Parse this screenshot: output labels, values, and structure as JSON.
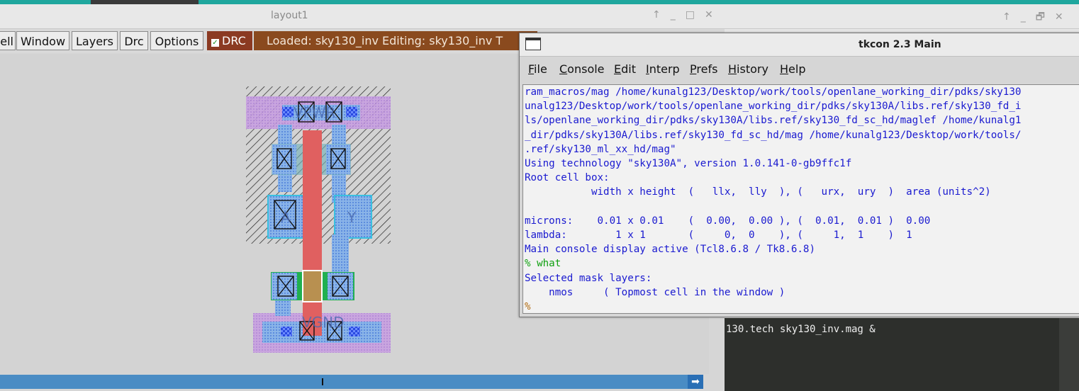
{
  "magic": {
    "title": "layout1",
    "menu": [
      "ell",
      "Window",
      "Layers",
      "Drc",
      "Options"
    ],
    "drc_label": "DRC",
    "status": "Loaded: sky130_inv Editing: sky130_inv T",
    "labels": {
      "vpwr": "VPWR",
      "vgnd": "VGND",
      "a": "A",
      "y": "Y"
    }
  },
  "tkcon": {
    "title": "tkcon 2.3 Main",
    "menu": [
      "File",
      "Console",
      "Edit",
      "Interp",
      "Prefs",
      "History",
      "Help"
    ],
    "lines": [
      {
        "text": "ram_macros/mag /home/kunalg123/Desktop/work/tools/openlane_working_dir/pdks/sky130",
        "color": "blue"
      },
      {
        "text": "unalg123/Desktop/work/tools/openlane_working_dir/pdks/sky130A/libs.ref/sky130_fd_i",
        "color": "blue"
      },
      {
        "text": "ls/openlane_working_dir/pdks/sky130A/libs.ref/sky130_fd_sc_hd/maglef /home/kunalg1",
        "color": "blue"
      },
      {
        "text": "_dir/pdks/sky130A/libs.ref/sky130_fd_sc_hd/mag /home/kunalg123/Desktop/work/tools/",
        "color": "blue"
      },
      {
        "text": ".ref/sky130_ml_xx_hd/mag\"",
        "color": "blue"
      },
      {
        "text": "Using technology \"sky130A\", version 1.0.141-0-gb9ffc1f",
        "color": "blue"
      },
      {
        "text": "Root cell box:",
        "color": "blue"
      },
      {
        "text": "           width x height  (   llx,  lly  ), (   urx,  ury  )  area (units^2)",
        "color": "blue"
      },
      {
        "text": "",
        "color": "blue"
      },
      {
        "text": "microns:    0.01 x 0.01    (  0.00,  0.00 ), (  0.01,  0.01 )  0.00",
        "color": "blue"
      },
      {
        "text": "lambda:        1 x 1       (     0,  0    ), (     1,  1    )  1",
        "color": "blue"
      },
      {
        "text": "Main console display active (Tcl8.6.8 / Tk8.6.8)",
        "color": "blue"
      },
      {
        "text": "% what",
        "color": "green"
      },
      {
        "text": "Selected mask layers:",
        "color": "blue"
      },
      {
        "text": "    nmos     ( Topmost cell in the window )",
        "color": "blue"
      },
      {
        "text": "%",
        "color": "orange"
      }
    ]
  },
  "terminal": {
    "line": "130.tech sky130_inv.mag &"
  }
}
